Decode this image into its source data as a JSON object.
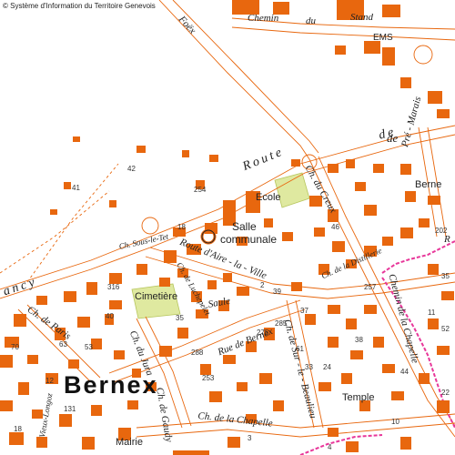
{
  "copyright": "© Système d'Information du Territoire Genevois",
  "labels": {
    "bernex_main": "Bernex",
    "berne_right": "Berne",
    "salle_communale_1": "Salle",
    "salle_communale_2": "communale",
    "ecole": "Ecole",
    "cimetiere": "Cimetière",
    "mairie": "Mairie",
    "temple": "Temple",
    "ems": "EMS"
  },
  "roads": {
    "route_de_chancy_a": "Route",
    "route_de_chancy_b": "de",
    "chancy": "ancy",
    "route_aire_la_ville": "Route d'Aire - la - Ville",
    "chemin_du_stand_1": "Chemin",
    "chemin_du_stand_2": "du",
    "chemin_du_stand_3": "Stand",
    "foex": "Foëx",
    "ch_du_creux": "Ch. du Creux",
    "pre_marais": "Pré - Marais",
    "ch_sous_le_tet": "Ch. Sous-le-Tet",
    "ch_luchepelet": "Ch. de Luchepelet",
    "ch_de_paris": "Ch. de Paris",
    "ch_de_la_distillerie": "Ch. de la Distillerie",
    "rue_de_bernex": "Rue de Bernex",
    "saule": "Saule",
    "ch_du_jura": "Ch. du Jura",
    "ch_sur_le_beaulieu": "Ch. de Sur - le - Beaulieu",
    "ch_de_la_chapelle": "Ch. de la Chapelle",
    "ch_gaudy": "Ch. de Gaudy",
    "chemin_chapelle": "Chemin de la Chapelle",
    "vieux_longoz": "Vieux-Longoz",
    "la_route": "de",
    "de_suffix": "de",
    "rue_bernex_vert": "Rue de Bernex",
    "de_top": "de",
    "route_right": "R"
  },
  "numbers": {
    "n42": "42",
    "n41": "41",
    "n254": "254",
    "n18": "18",
    "n202": "202",
    "n316": "316",
    "n53": "53",
    "n63": "63",
    "n70": "70",
    "n35": "35",
    "n40": "40",
    "n12": "12",
    "n288": "288",
    "n253": "253",
    "n275": "275",
    "n285": "285",
    "n257": "257",
    "n46": "46",
    "n37": "37",
    "n39": "39",
    "n2": "2",
    "n61": "61",
    "n33": "33",
    "n24": "24",
    "n38": "38",
    "n11": "11",
    "n52": "52",
    "n44": "44",
    "n22": "22",
    "n35b": "35",
    "n10": "10",
    "n4": "4",
    "n3": "3",
    "n18b": "18",
    "n131": "131"
  },
  "colors": {
    "building": "#e8670e",
    "road_line": "#e8670e",
    "green_area": "#dfe9a0",
    "marker": "#e8670e",
    "pink_route": "#e8379a"
  }
}
